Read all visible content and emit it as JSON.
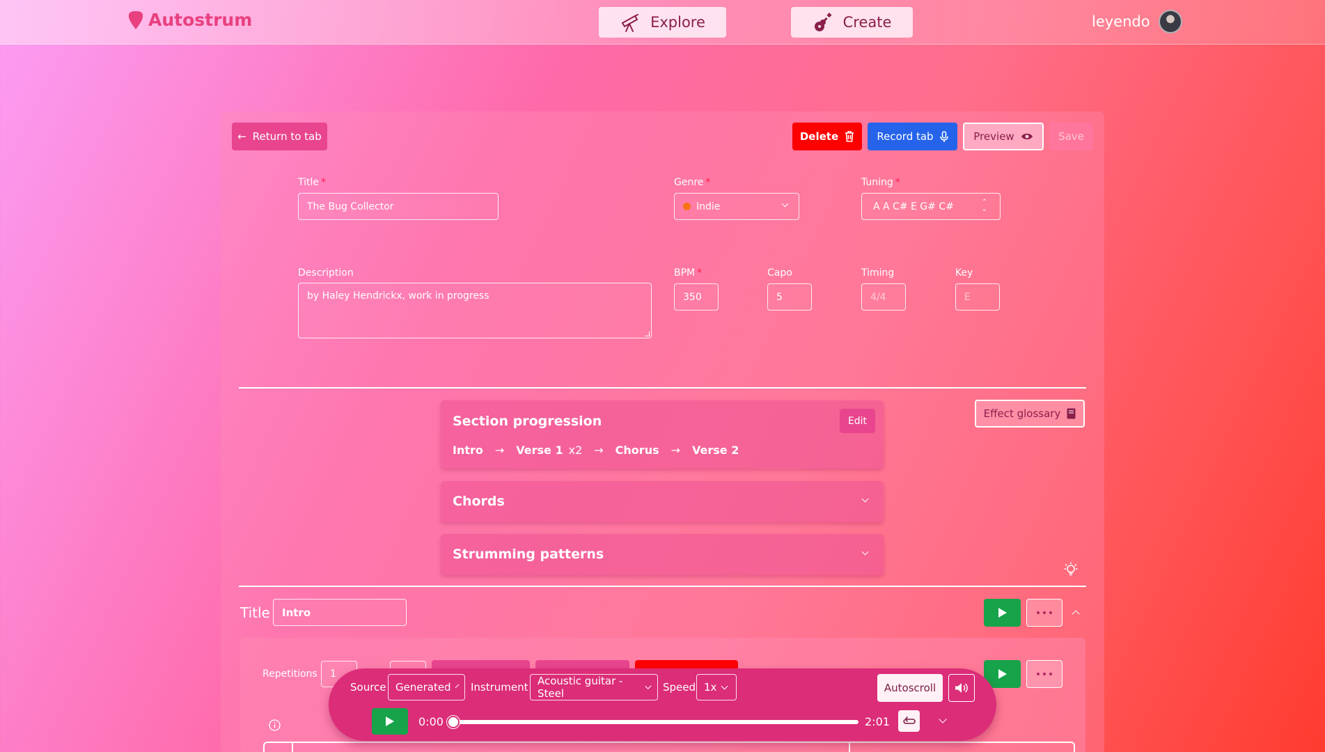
{
  "nav": {
    "brand": "Autostrum",
    "explore_label": "Explore",
    "create_label": "Create",
    "username": "leyendo",
    "icons": {
      "brand": "guitar-pick-icon",
      "explore": "telescope-icon",
      "create": "guitar-icon"
    }
  },
  "toolbar": {
    "return_label": "Return to tab",
    "delete_label": "Delete",
    "record_label": "Record tab",
    "preview_label": "Preview",
    "save_label": "Save"
  },
  "form": {
    "title_label": "Title",
    "title_value": "The Bug Collector",
    "genre_label": "Genre",
    "genre_value": "Indie",
    "tuning_label": "Tuning",
    "tuning_value": "A A C# E G# C#",
    "description_label": "Description",
    "description_value": "by Haley Hendrickx, work in progress",
    "bpm_label": "BPM",
    "bpm_value": "350",
    "capo_label": "Capo",
    "capo_value": "5",
    "timing_label": "Timing",
    "timing_value": "4/4",
    "key_label": "Key",
    "key_value": "E"
  },
  "section_progression": {
    "title": "Section progression",
    "edit_label": "Edit",
    "items": [
      {
        "name": "Intro",
        "reps": ""
      },
      {
        "name": "Verse 1",
        "reps": "x2"
      },
      {
        "name": "Chorus",
        "reps": ""
      },
      {
        "name": "Verse 2",
        "reps": ""
      }
    ],
    "arrow": "→"
  },
  "effect_glossary_label": "Effect glossary",
  "chords_title": "Chords",
  "strumming_title": "Strumming patterns",
  "section": {
    "title_label": "Title",
    "title_value": "Intro",
    "repetitions_label": "Repetitions",
    "repetitions_value": "1"
  },
  "player": {
    "source_label": "Source",
    "source_value": "Generated",
    "instrument_label": "Instrument",
    "instrument_value": "Acoustic guitar - Steel",
    "speed_label": "Speed",
    "speed_value": "1x",
    "autoscroll_label": "Autoscroll",
    "current_time": "0:00",
    "total_time": "2:01",
    "progress": 0
  },
  "colors": {
    "brand_pink": "#e8407f",
    "delete_red": "#ff0000",
    "record_blue": "#2563eb",
    "play_green": "#16a34a",
    "player_bg": "#dc2d78",
    "genre_dot": "#f97316"
  }
}
